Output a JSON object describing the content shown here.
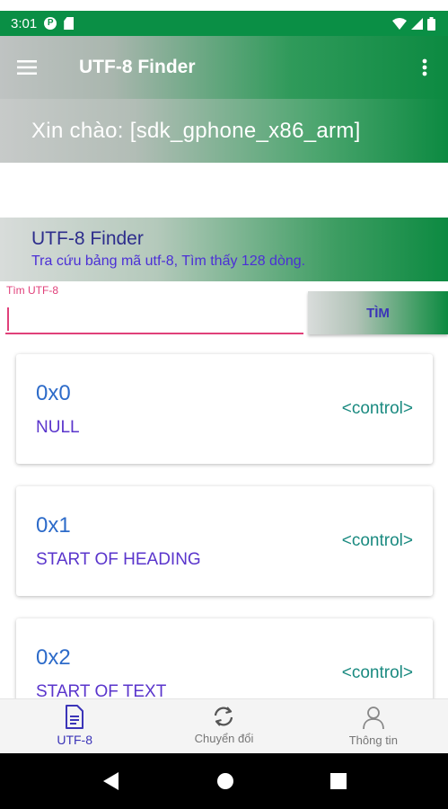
{
  "status_bar": {
    "time": "3:01",
    "notif_icons": [
      "circle-app-icon",
      "sd-card-icon"
    ],
    "right_icons": [
      "wifi-icon",
      "signal-icon",
      "battery-icon"
    ]
  },
  "app_bar": {
    "title": "UTF-8 Finder",
    "menu_icon": "hamburger-menu-icon",
    "more_icon": "more-vert-icon"
  },
  "greeting": {
    "text": "Xin chào: [sdk_gphone_x86_arm]"
  },
  "info": {
    "title": "UTF-8 Finder",
    "subtitle": "Tra cứu bảng mã utf-8, Tìm thấy 128 dòng."
  },
  "search": {
    "label": "Tìm UTF-8",
    "value": "",
    "button_label": "TÌM"
  },
  "results": [
    {
      "code": "0x0",
      "name": "NULL",
      "type": "<control>"
    },
    {
      "code": "0x1",
      "name": "START OF HEADING",
      "type": "<control>"
    },
    {
      "code": "0x2",
      "name": "START OF TEXT",
      "type": "<control>"
    }
  ],
  "bottom_nav": [
    {
      "label": "UTF-8",
      "icon": "document-icon",
      "active": true
    },
    {
      "label": "Chuyển đổi",
      "icon": "sync-icon",
      "active": false
    },
    {
      "label": "Thông tin",
      "icon": "person-icon",
      "active": false
    }
  ],
  "colors": {
    "primary_green": "#0c8a41",
    "accent_pink": "#e0407a",
    "accent_indigo": "#3b34b8",
    "code_blue": "#2d6bc9",
    "type_teal": "#1a8a80"
  }
}
